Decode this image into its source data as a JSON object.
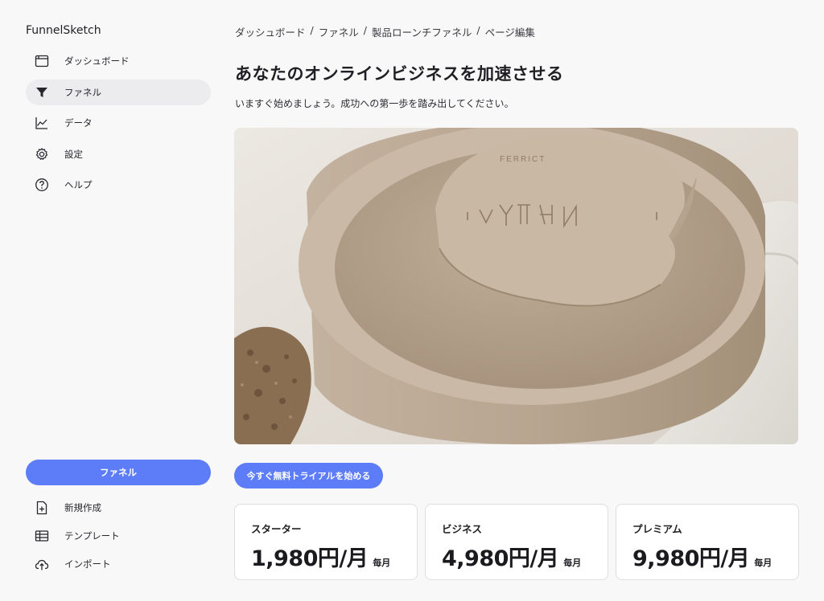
{
  "sidebar": {
    "brand": "FunnelSketch",
    "nav": [
      {
        "label": "ダッシュボード",
        "icon": "dashboard-icon",
        "active": false
      },
      {
        "label": "ファネル",
        "icon": "funnel-icon",
        "active": true
      },
      {
        "label": "データ",
        "icon": "chart-line-icon",
        "active": false
      },
      {
        "label": "設定",
        "icon": "gear-icon",
        "active": false
      },
      {
        "label": "ヘルプ",
        "icon": "help-icon",
        "active": false
      }
    ],
    "primary_button": "ファネル",
    "bottom": [
      {
        "label": "新規作成",
        "icon": "new-file-icon"
      },
      {
        "label": "テンプレート",
        "icon": "table-icon"
      },
      {
        "label": "インポート",
        "icon": "cloud-upload-icon"
      }
    ]
  },
  "breadcrumb": [
    "ダッシュボード",
    "ファネル",
    "製品ローンチファネル",
    "ページ編集"
  ],
  "main": {
    "title": "あなたのオンラインビジネスを加速させる",
    "subtitle": "いますぐ始めましょう。成功への第一歩を踏み出してください。",
    "hero_image": "product-photo",
    "cta_label": "今すぐ無料トライアルを始める"
  },
  "plans": [
    {
      "name": "スターター",
      "price": "1,980円/月",
      "period": "毎月"
    },
    {
      "name": "ビジネス",
      "price": "4,980円/月",
      "period": "毎月"
    },
    {
      "name": "プレミアム",
      "price": "9,980円/月",
      "period": "毎月"
    }
  ],
  "colors": {
    "accent": "#5d7cf7",
    "background": "#f8f8f9",
    "active_nav": "#ececef"
  }
}
